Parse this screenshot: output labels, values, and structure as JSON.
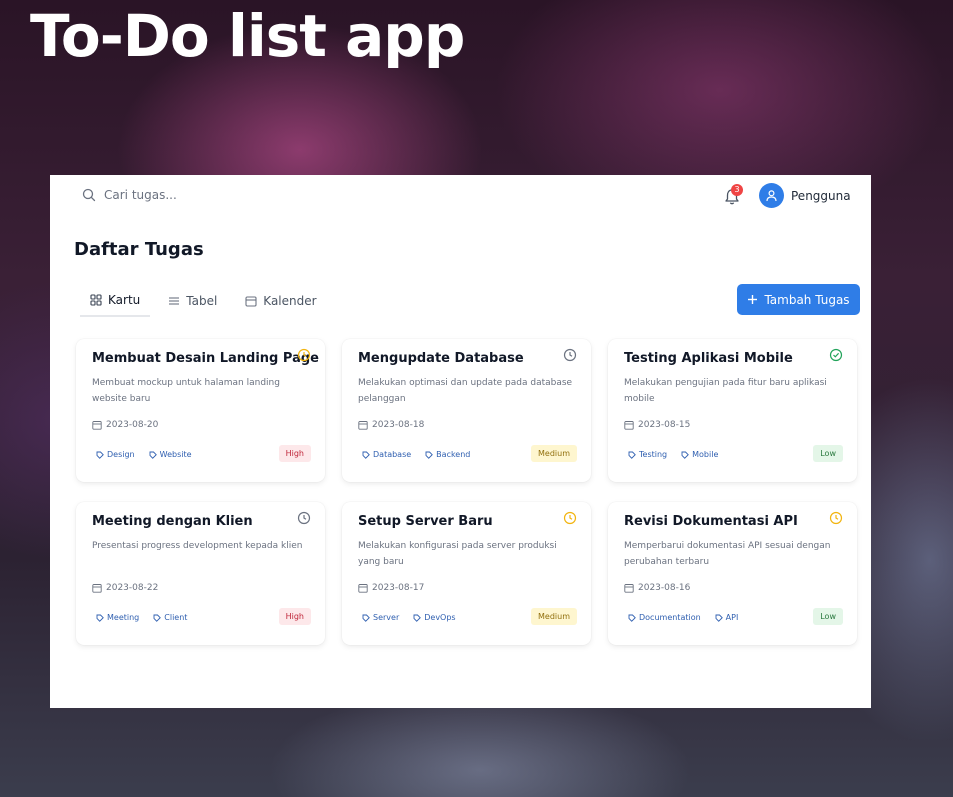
{
  "hero": {
    "title": "To-Do list app"
  },
  "search": {
    "placeholder": "Cari tugas..."
  },
  "notifications": {
    "count": "3"
  },
  "user": {
    "name": "Pengguna"
  },
  "page": {
    "title": "Daftar Tugas"
  },
  "tabs": [
    {
      "label": "Kartu",
      "icon": "grid-icon",
      "active": true
    },
    {
      "label": "Tabel",
      "icon": "list-icon",
      "active": false
    },
    {
      "label": "Kalender",
      "icon": "calendar-icon",
      "active": false
    }
  ],
  "add_button": {
    "label": "Tambah Tugas"
  },
  "colors": {
    "accent": "#2f7de7",
    "status_pending": "#f2b40f",
    "status_clock": "#6b7280",
    "status_done": "#22a35a",
    "high": "#c0263a",
    "medium": "#92700e",
    "low": "#2a7a3f"
  },
  "cards": [
    {
      "title": "Membuat Desain Landing Page",
      "status_icon": "clock-icon-yellow",
      "description": "Membuat mockup untuk halaman landing website baru",
      "date": "2023-08-20",
      "tags": [
        "Design",
        "Website"
      ],
      "priority": "High"
    },
    {
      "title": "Mengupdate Database",
      "status_icon": "clock-icon-gray",
      "description": "Melakukan optimasi dan update pada database pelanggan",
      "date": "2023-08-18",
      "tags": [
        "Database",
        "Backend"
      ],
      "priority": "Medium"
    },
    {
      "title": "Testing Aplikasi Mobile",
      "status_icon": "check-circle-icon",
      "description": "Melakukan pengujian pada fitur baru aplikasi mobile",
      "date": "2023-08-15",
      "tags": [
        "Testing",
        "Mobile"
      ],
      "priority": "Low"
    },
    {
      "title": "Meeting dengan Klien",
      "status_icon": "clock-icon-gray",
      "description": "Presentasi progress development kepada klien",
      "date": "2023-08-22",
      "tags": [
        "Meeting",
        "Client"
      ],
      "priority": "High"
    },
    {
      "title": "Setup Server Baru",
      "status_icon": "clock-icon-yellow",
      "description": "Melakukan konfigurasi pada server produksi yang baru",
      "date": "2023-08-17",
      "tags": [
        "Server",
        "DevOps"
      ],
      "priority": "Medium"
    },
    {
      "title": "Revisi Dokumentasi API",
      "status_icon": "clock-icon-yellow",
      "description": "Memperbarui dokumentasi API sesuai dengan perubahan terbaru",
      "date": "2023-08-16",
      "tags": [
        "Documentation",
        "API"
      ],
      "priority": "Low"
    }
  ]
}
